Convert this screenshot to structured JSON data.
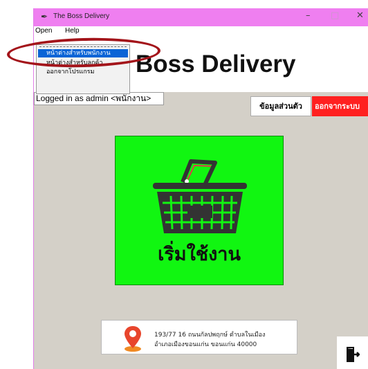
{
  "window": {
    "title": "The Boss Delivery",
    "title_bar_color": "#ef7ff0",
    "controls": {
      "minimize": "–",
      "maximize": "□",
      "close": "✕"
    }
  },
  "menubar": {
    "items": [
      "Open",
      "Help"
    ]
  },
  "dropdown": {
    "items": [
      {
        "label": "หน้าต่างสำหรับพนักงาน",
        "selected": true
      },
      {
        "label": "หน้าต่างสำหรับลูกค้า",
        "selected": false
      },
      {
        "label": "ออกจากโปรแกรม",
        "selected": false
      }
    ],
    "highlight_color": "#0a64d6"
  },
  "header": {
    "brand": "Boss Delivery"
  },
  "status": {
    "logged_in_text": "Logged in as admin <พนักงาน>"
  },
  "buttons": {
    "profile_label": "ข้อมูลส่วนตัว",
    "logout_label": "ออกจากระบบ",
    "logout_color": "#ff2020"
  },
  "start": {
    "label": "เริ่มใช้งาน",
    "color": "#11f611",
    "icon": "shopping-basket-icon"
  },
  "address": {
    "line1": "193/77 16 ถนนกัลปพฤกษ์ ตำบลในเมือง",
    "line2": "อำเภอเมืองขอนแก่น ขอนแก่น 40000",
    "icon": "location-pin-icon"
  },
  "exit": {
    "icon": "exit-door-icon"
  },
  "annotation": {
    "color": "#a3141a"
  }
}
